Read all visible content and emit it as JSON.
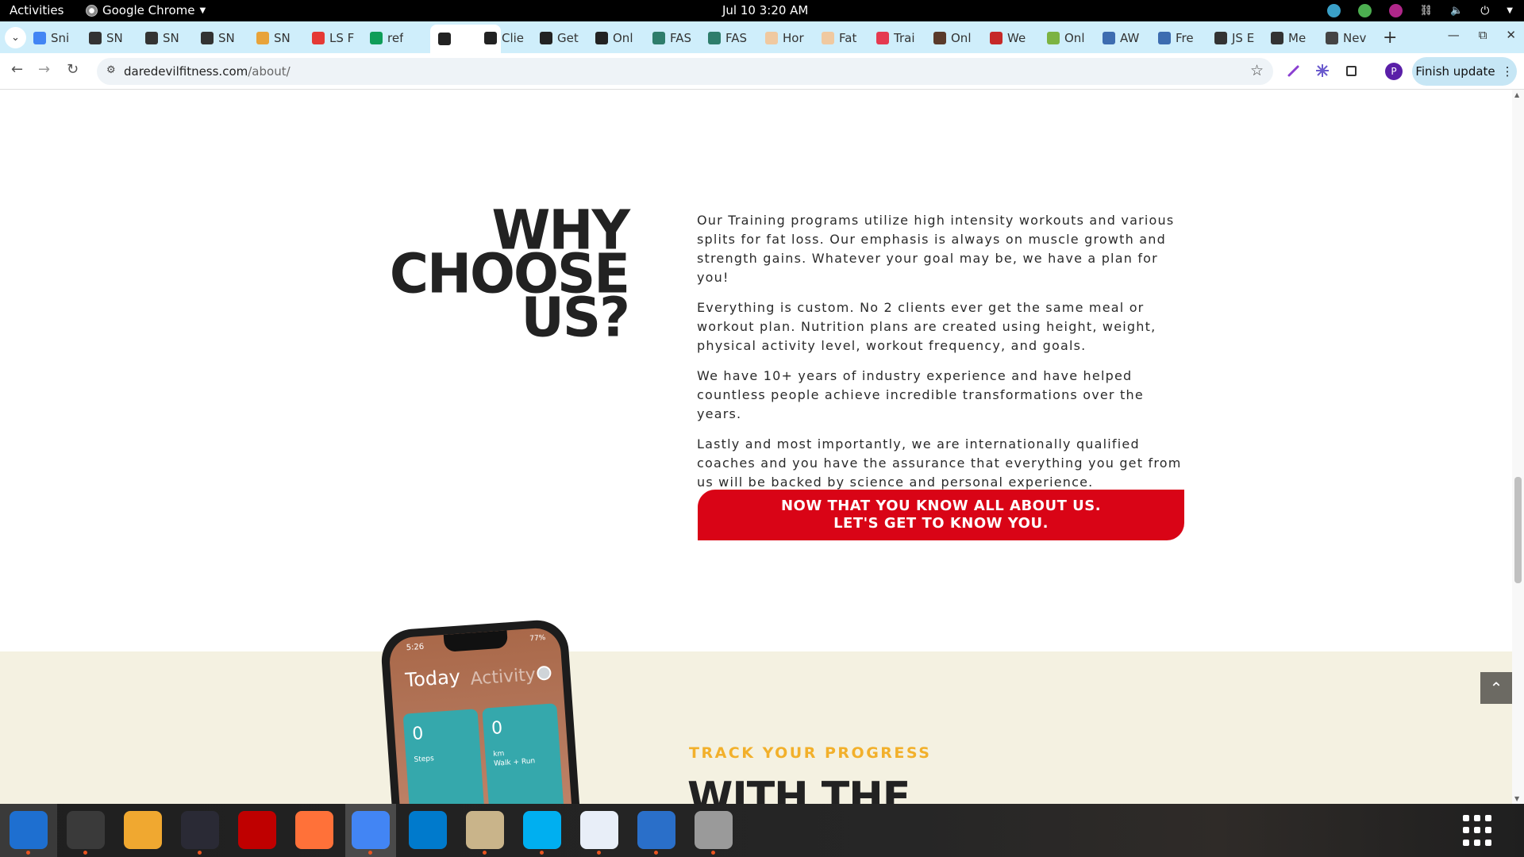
{
  "topbar": {
    "activities": "Activities",
    "app_name": "Google Chrome",
    "clock": "Jul 10  3:20 AM"
  },
  "tabs": [
    {
      "label": "Sni",
      "icon": "google-docs-icon",
      "color": "#4285f4"
    },
    {
      "label": "SN",
      "icon": "snp-icon",
      "color": "#333333"
    },
    {
      "label": "SN",
      "icon": "snp-icon",
      "color": "#333333"
    },
    {
      "label": "SN",
      "icon": "snp-icon",
      "color": "#333333"
    },
    {
      "label": "SN",
      "icon": "burger-icon",
      "color": "#e8a33a"
    },
    {
      "label": "LS F",
      "icon": "ls-icon",
      "color": "#e53935"
    },
    {
      "label": "ref",
      "icon": "google-sheets-plus-icon",
      "color": "#0f9d58"
    },
    {
      "label": "",
      "icon": "daredevil-icon",
      "color": "#222222",
      "active": true
    },
    {
      "label": "Clie",
      "icon": "daredevil-icon",
      "color": "#222222"
    },
    {
      "label": "Get",
      "icon": "daredevil-icon",
      "color": "#222222"
    },
    {
      "label": "Onl",
      "icon": "daredevil-icon",
      "color": "#222222"
    },
    {
      "label": "FAS",
      "icon": "fas-icon",
      "color": "#2e7d6b"
    },
    {
      "label": "FAS",
      "icon": "fas-icon",
      "color": "#2e7d6b"
    },
    {
      "label": "Hor",
      "icon": "hand-icon",
      "color": "#f0c9a0"
    },
    {
      "label": "Fat",
      "icon": "hand-icon",
      "color": "#f0c9a0"
    },
    {
      "label": "Trai",
      "icon": "heart-icon",
      "color": "#e53950"
    },
    {
      "label": "Onl",
      "icon": "person-icon",
      "color": "#5a3a2a"
    },
    {
      "label": "We",
      "icon": "person-icon",
      "color": "#c62828"
    },
    {
      "label": "Onl",
      "icon": "image-icon",
      "color": "#7cb342"
    },
    {
      "label": "AW",
      "icon": "mountain-icon",
      "color": "#3d6cb0"
    },
    {
      "label": "Fre",
      "icon": "mountain-icon",
      "color": "#3d6cb0"
    },
    {
      "label": "JS E",
      "icon": "shield-icon",
      "color": "#333333"
    },
    {
      "label": "Me",
      "icon": "shield-icon",
      "color": "#333333"
    },
    {
      "label": "Nev",
      "icon": "globe-icon",
      "color": "#444444"
    }
  ],
  "toolbar": {
    "url_host": "daredevilfitness.com",
    "url_path": "/about/",
    "finish_update": "Finish update",
    "profile_initial": "P"
  },
  "page": {
    "heading_lines": [
      "WHY",
      "CHOOSE",
      "US?"
    ],
    "paragraphs": [
      "Our Training programs utilize high intensity workouts and various splits for fat loss. Our emphasis is always on muscle growth and strength gains. Whatever your goal may be, we have a plan for you!",
      "Everything is custom. No 2 clients ever get the same meal or workout plan. Nutrition plans are created using height, weight, physical activity level, workout frequency, and goals.",
      "We have 10+ years of industry experience and have helped countless people achieve incredible transformations over the years.",
      "Lastly and most importantly, we are internationally qualified coaches and you have the assurance that everything you get from us will be backed by science and personal experience."
    ],
    "cta_line1": "NOW THAT YOU KNOW ALL ABOUT US.",
    "cta_line2": "LET'S GET TO KNOW YOU.",
    "track_label": "TRACK YOUR PROGRESS",
    "with_the": "WITH THE",
    "phone": {
      "time": "5:26",
      "battery": "77%",
      "tab_today": "Today",
      "tab_activity": "Activity",
      "card1_value": "0",
      "card1_label": "Steps",
      "card2_value": "0",
      "card2_unit": "km",
      "card2_label": "Walk + Run"
    }
  },
  "colors": {
    "accent_red": "#d90416",
    "track_yellow": "#f2b02b",
    "beige": "#f4f1e1",
    "tabstrip": "#cfeefb"
  },
  "dock": [
    {
      "name": "thunderbird",
      "icon": "thunderbird-icon",
      "color": "#1e6fd0"
    },
    {
      "name": "terminal",
      "icon": "terminal-icon",
      "color": "#3a3a3a"
    },
    {
      "name": "calculator",
      "icon": "calculator-icon",
      "color": "#f0a830"
    },
    {
      "name": "system-monitor",
      "icon": "system-monitor-icon",
      "color": "#2a2a35"
    },
    {
      "name": "filezilla",
      "icon": "filezilla-icon",
      "color": "#bf0000"
    },
    {
      "name": "firefox",
      "icon": "firefox-icon",
      "color": "#ff7139"
    },
    {
      "name": "chrome",
      "icon": "chrome-icon",
      "color": "#4285f4"
    },
    {
      "name": "vscode",
      "icon": "vscode-icon",
      "color": "#007acc"
    },
    {
      "name": "files",
      "icon": "files-icon",
      "color": "#c9b48a"
    },
    {
      "name": "skype",
      "icon": "skype-icon",
      "color": "#00aff0"
    },
    {
      "name": "text-editor",
      "icon": "text-editor-icon",
      "color": "#e8eef8"
    },
    {
      "name": "libreoffice-writer",
      "icon": "writer-icon",
      "color": "#2a6fc9"
    },
    {
      "name": "disk-utility",
      "icon": "disk-icon",
      "color": "#9a9a9a"
    }
  ]
}
